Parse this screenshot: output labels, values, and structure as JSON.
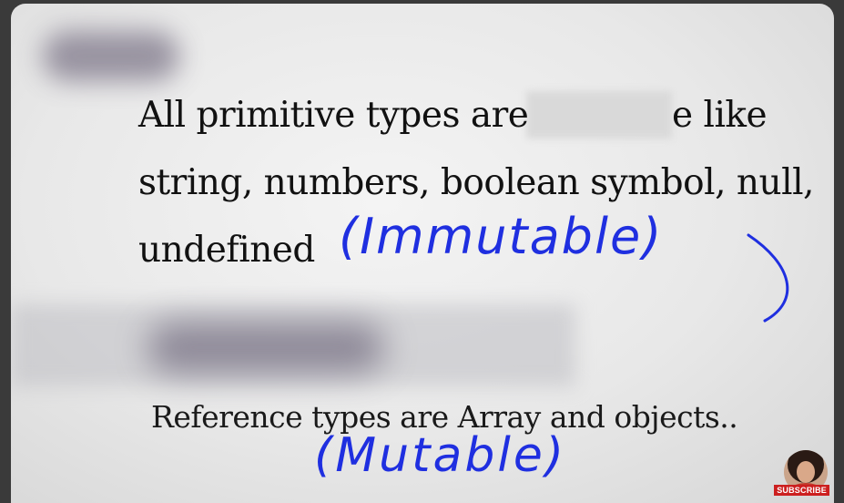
{
  "slide": {
    "line1_start": "All primitive types are",
    "line1_end": "e like",
    "line2": "string, numbers, boolean symbol, null,",
    "line3": "undefined",
    "reference_line": "Reference types are Array and objects.."
  },
  "annotations": {
    "primitive_note": "(Immutable)",
    "reference_note": "(Mutable)",
    "ink_color": "#1f2fe0"
  },
  "channel": {
    "subscribe_label": "SUBSCRIBE"
  }
}
